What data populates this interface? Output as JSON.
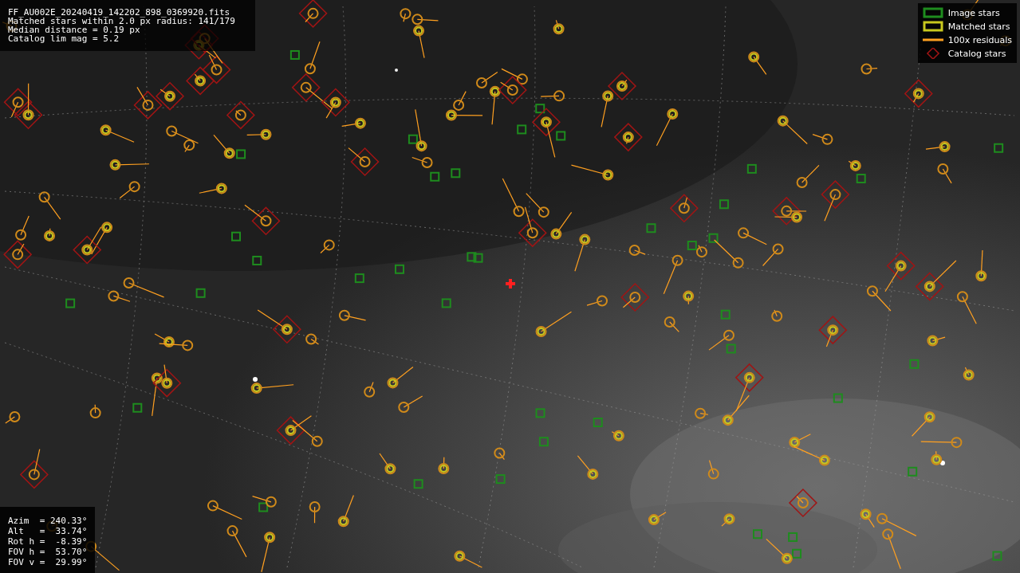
{
  "header": {
    "lines": [
      "FF_AU002E_20240419_142202_898_0369920.fits",
      "Matched stars within 2.0 px radius: 141/179",
      "Median distance = 0.19 px",
      "Catalog lim mag = 5.2"
    ]
  },
  "legend": {
    "items": [
      {
        "label": "Image stars",
        "color": "#1e8c1e"
      },
      {
        "kind": "matched",
        "label": "Matched stars",
        "color": "#c8c81e"
      },
      {
        "kind": "residual",
        "label": "100x residuals",
        "color": "#ffa020"
      },
      {
        "kind": "catalog",
        "label": "Catalog stars",
        "color": "#a01414"
      }
    ]
  },
  "pointing": {
    "lines": [
      "Azim  = 240.33°",
      "Alt   =  33.74°",
      "Rot h =  -8.39°",
      "FOV h =  53.70°",
      "FOV v =  29.99°"
    ]
  }
}
